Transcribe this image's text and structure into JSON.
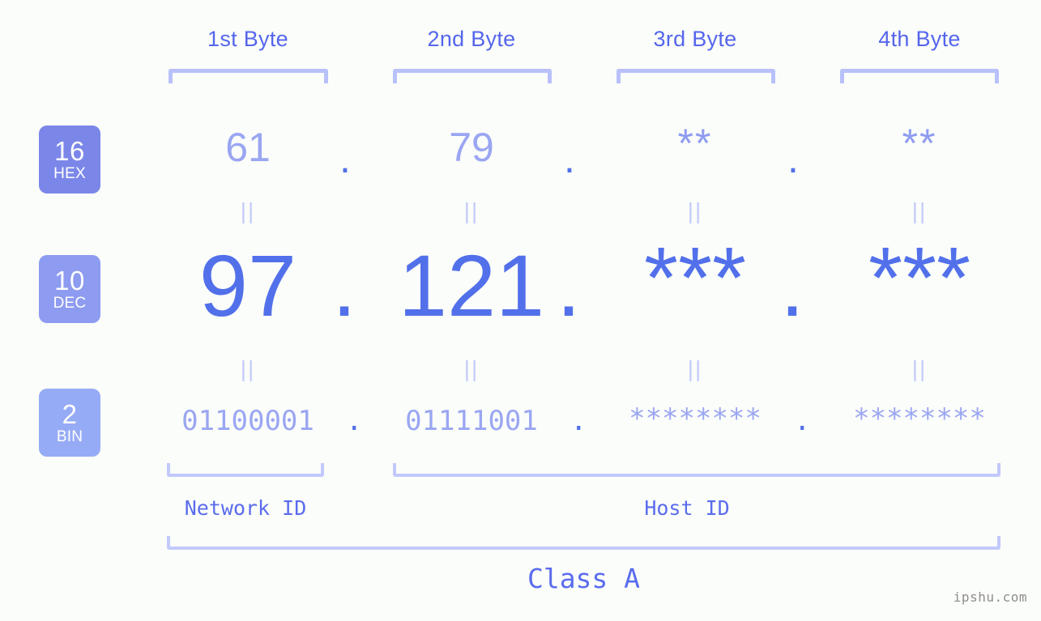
{
  "background_color": "#fbfdfa",
  "accent_colors": {
    "label_blue": "#5566ec",
    "bracket_lavender": "#b9c1fb",
    "value_light": "#9aa6f2",
    "value_strong": "#5270ea",
    "equals_marker": "#c4cbfb",
    "badge_hex": "#7b87e8",
    "badge_dec": "#8d9bf0",
    "badge_bin": "#96abf5",
    "watermark_gray": "#8d8d8d"
  },
  "byte_headers": [
    {
      "label": "1st Byte"
    },
    {
      "label": "2nd Byte"
    },
    {
      "label": "3rd Byte"
    },
    {
      "label": "4th Byte"
    }
  ],
  "radix_badges": [
    {
      "number": "16",
      "name": "HEX"
    },
    {
      "number": "10",
      "name": "DEC"
    },
    {
      "number": "2",
      "name": "BIN"
    }
  ],
  "rows": {
    "hex": {
      "radix_number": "16",
      "radix_name": "HEX",
      "values": [
        "61",
        "79",
        "**",
        "**"
      ],
      "separator": "."
    },
    "dec": {
      "radix_number": "10",
      "radix_name": "DEC",
      "values": [
        "97",
        "121",
        "***",
        "***"
      ],
      "separator": "."
    },
    "bin": {
      "radix_number": "2",
      "radix_name": "BIN",
      "values": [
        "01100001",
        "01111001",
        "********",
        "********"
      ],
      "separator": "."
    }
  },
  "equality_marker": "||",
  "sections": {
    "network_id": "Network ID",
    "host_id": "Host ID",
    "class": "Class A"
  },
  "watermark": "ipshu.com"
}
